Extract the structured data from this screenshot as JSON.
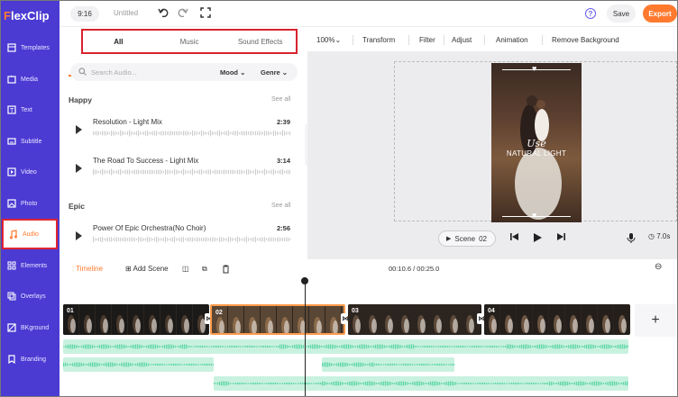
{
  "app": {
    "logo_mark": "F",
    "logo_text": "lexClip"
  },
  "sidebar": {
    "items": [
      {
        "label": "Templates",
        "icon": "templates-icon"
      },
      {
        "label": "Media",
        "icon": "media-icon"
      },
      {
        "label": "Text",
        "icon": "text-icon"
      },
      {
        "label": "Subtitle",
        "icon": "subtitle-icon"
      },
      {
        "label": "Video",
        "icon": "video-icon"
      },
      {
        "label": "Photo",
        "icon": "photo-icon"
      },
      {
        "label": "Audio",
        "icon": "audio-icon",
        "active": true
      },
      {
        "label": "Elements",
        "icon": "elements-icon"
      },
      {
        "label": "Overlays",
        "icon": "overlays-icon"
      },
      {
        "label": "BKground",
        "icon": "background-icon"
      },
      {
        "label": "Branding",
        "icon": "branding-icon"
      }
    ]
  },
  "topbar": {
    "ratio": "9:16",
    "project_name": "Untitled",
    "help": "?",
    "save_label": "Save",
    "export_label": "Export"
  },
  "audio_panel": {
    "tabs": [
      "All",
      "Music",
      "Sound Effects"
    ],
    "active_tab": "All",
    "search_placeholder": "Search Audio...",
    "filters": [
      "Mood",
      "Genre"
    ],
    "sections": [
      {
        "title": "Happy",
        "see_all": "See all",
        "tracks": [
          {
            "title": "Resolution - Light Mix",
            "duration": "2:39"
          },
          {
            "title": "The Road To Success - Light Mix",
            "duration": "3:14"
          }
        ]
      },
      {
        "title": "Epic",
        "see_all": "See all",
        "tracks": [
          {
            "title": "Power Of Epic Orchestra(No Choir)",
            "duration": "2:56"
          }
        ]
      }
    ]
  },
  "edit_toolbar": {
    "zoom": "100%",
    "items": [
      "Transform",
      "Filter",
      "Adjust",
      "Animation",
      "Remove Background"
    ]
  },
  "preview": {
    "text_line1": "Use",
    "text_line2": "NATURAL LIGHT",
    "scene_label": "Scene",
    "scene_number": "02",
    "duration": "7.0s"
  },
  "timeline": {
    "label": "Timeline",
    "add_scene": "Add Scene",
    "current_time": "00:10.6",
    "total_time": "00:25.0",
    "time_display": "00:10.6 / 00:25.0",
    "clips": [
      "01",
      "02",
      "03",
      "04"
    ],
    "selected_clip": "02",
    "add_label": "+"
  },
  "colors": {
    "sidebar": "#4b3bd3",
    "accent": "#ff7a2f",
    "highlight": "#e0242f",
    "audio_track": "#c9f1e0",
    "waveform": "#5cd6a4"
  }
}
